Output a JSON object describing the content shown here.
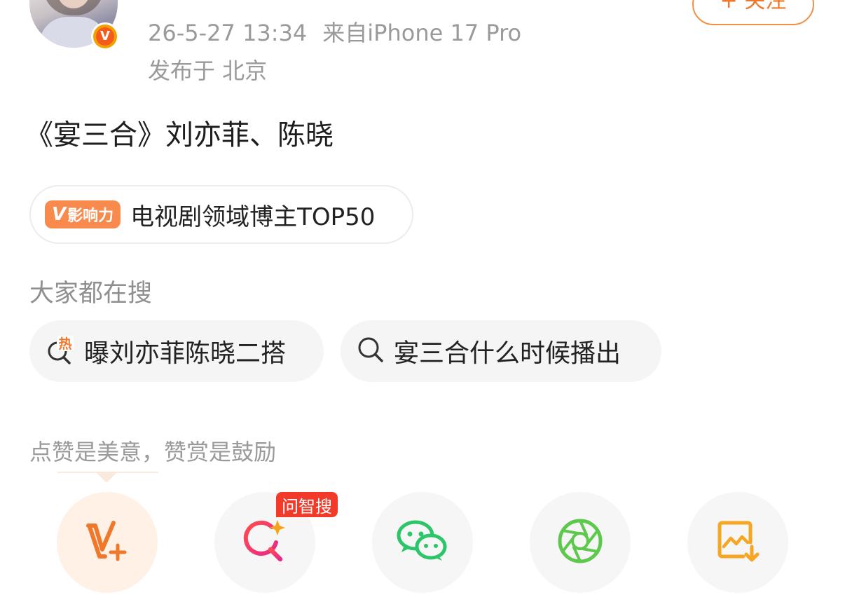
{
  "header": {
    "follow_label": "+ 关注",
    "timestamp": "26-5-27 13:34",
    "source": "来自iPhone 17 Pro",
    "location": "发布于 北京"
  },
  "post": {
    "text": "《宴三合》刘亦菲、陈晓"
  },
  "influence": {
    "tag_v": "V",
    "tag_label": "影响力",
    "text": "电视剧领域博主TOP50"
  },
  "search": {
    "title": "大家都在搜",
    "chips": [
      {
        "label": "曝刘亦菲陈晓二搭",
        "icon": "hot-search-icon",
        "hot_label": "热"
      },
      {
        "label": "宴三合什么时候播出",
        "icon": "search-icon"
      }
    ]
  },
  "praise": {
    "text": "点赞是美意，赞赏是鼓励"
  },
  "share_bar": {
    "items": [
      {
        "icon": "v-plus-icon"
      },
      {
        "icon": "ai-search-icon",
        "badge": "问智搜"
      },
      {
        "icon": "wechat-icon"
      },
      {
        "icon": "moments-icon"
      },
      {
        "icon": "save-image-icon"
      }
    ]
  },
  "colors": {
    "accent_orange": "#f0782a",
    "wechat_green": "#2dc46a",
    "moments_green": "#5cc84c",
    "badge_red": "#f23a2a",
    "save_orange": "#f5a623"
  }
}
